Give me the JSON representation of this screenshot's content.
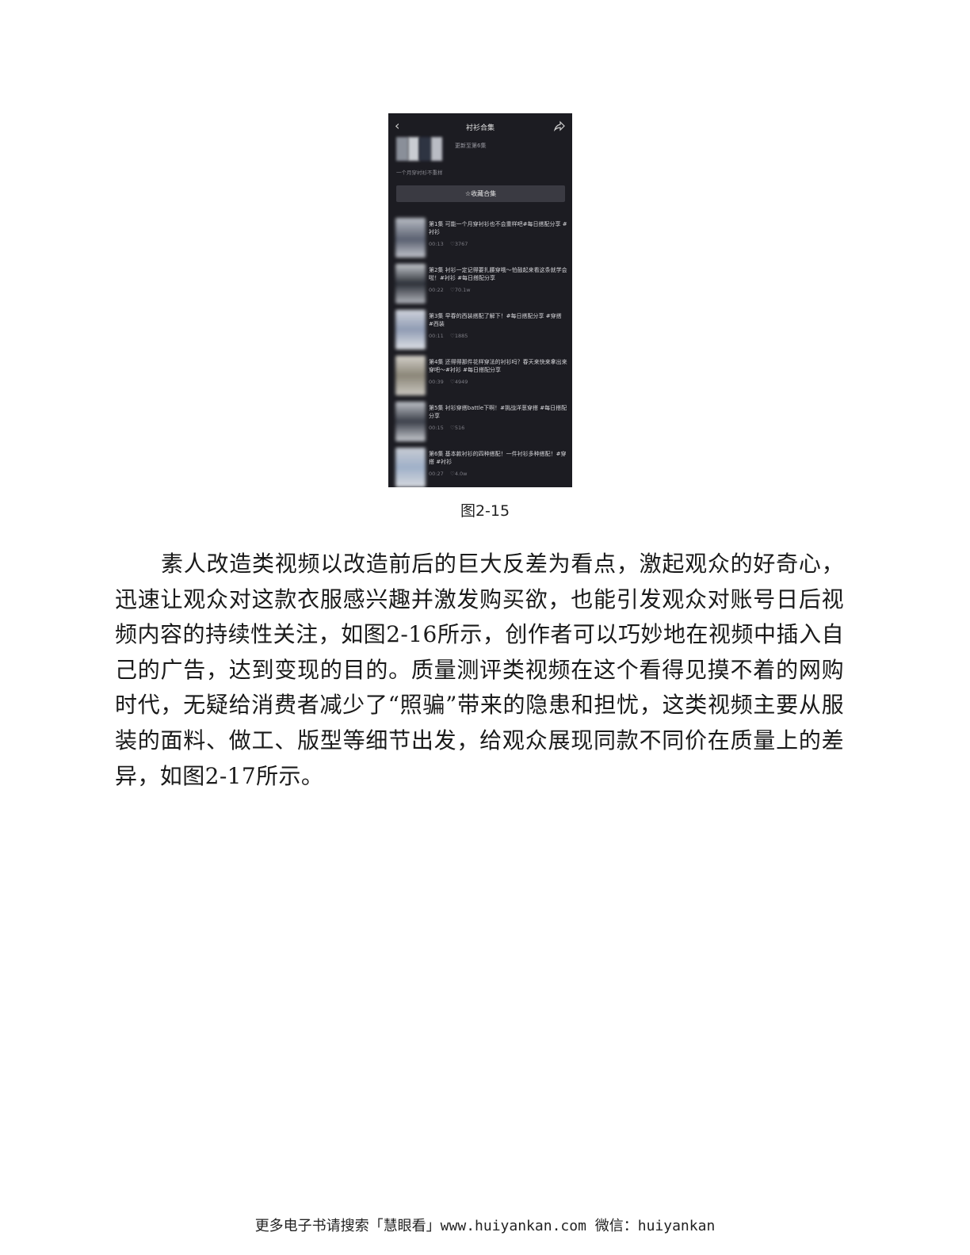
{
  "figure": {
    "header": {
      "back_icon": "chevron-left-icon",
      "title": "衬衫合集",
      "share_icon": "share-icon"
    },
    "collection": {
      "update_text": "更新至第6集",
      "description": "一个月穿衬衫不重样",
      "collect_button": "☆收藏合集"
    },
    "episodes": [
      {
        "title": "第1集  可能一个月穿衬衫也不会重样吧#每日搭配分享 #衬衫",
        "duration": "00:13",
        "likes": "♡3767"
      },
      {
        "title": "第2集  衬衫一定记得要扎腰穿哦～怕鼓起来看这条就学会啦！#衬衫 #每日搭配分享",
        "duration": "00:22",
        "likes": "♡70.1w"
      },
      {
        "title": "第3集  早春的西装搭配了解下！#每日搭配分享 #穿搭 #西装",
        "duration": "00:11",
        "likes": "♡1885"
      },
      {
        "title": "第4集  还得得那件花样穿法的衬衫吗？春天来快来拿出来穿吧～#衬衫 #每日搭配分享",
        "duration": "00:39",
        "likes": "♡4949"
      },
      {
        "title": "第5集  衬衫穿搭battle下啊！#挑战洋葱穿搭 #每日搭配分享",
        "duration": "00:15",
        "likes": "♡516"
      },
      {
        "title": "第6集  基本款衬衫的四种搭配！一件衬衫多种搭配！#穿搭 #衬衫",
        "duration": "00:27",
        "likes": "♡4.0w"
      }
    ],
    "caption": "图2-15"
  },
  "body_text": "素人改造类视频以改造前后的巨大反差为看点，激起观众的好奇心，迅速让观众对这款衣服感兴趣并激发购买欲，也能引发观众对账号日后视频内容的持续性关注，如图2-16所示，创作者可以巧妙地在视频中插入自己的广告，达到变现的目的。质量测评类视频在这个看得见摸不着的网购时代，无疑给消费者减少了“照骗”带来的隐患和担忧，这类视频主要从服装的面料、做工、版型等细节出发，给观众展现同款不同价在质量上的差异，如图2-17所示。",
  "footer": "更多电子书请搜索「慧眼看」www.huiyankan.com  微信：huiyankan"
}
